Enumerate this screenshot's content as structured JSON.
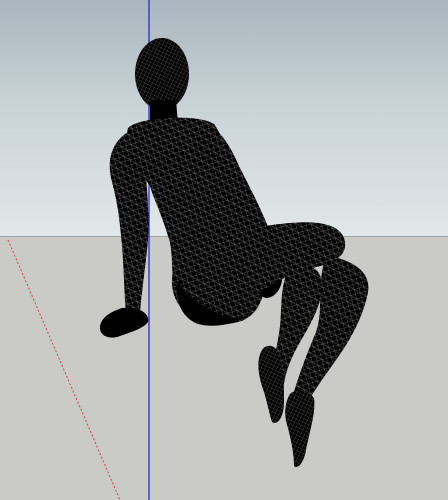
{
  "viewport": {
    "sky_top_color": "#a9b6bd",
    "sky_bottom_color": "#e2e7e9",
    "ground_color": "#cacac6"
  },
  "axes": {
    "blue_axis_color": "#1d1dcc",
    "red_axis_color": "#cc4444"
  },
  "model": {
    "description_icon": "seated-figure-mesh-icon",
    "fill_color": "#000000",
    "mesh_color": "#5a5a5a"
  }
}
